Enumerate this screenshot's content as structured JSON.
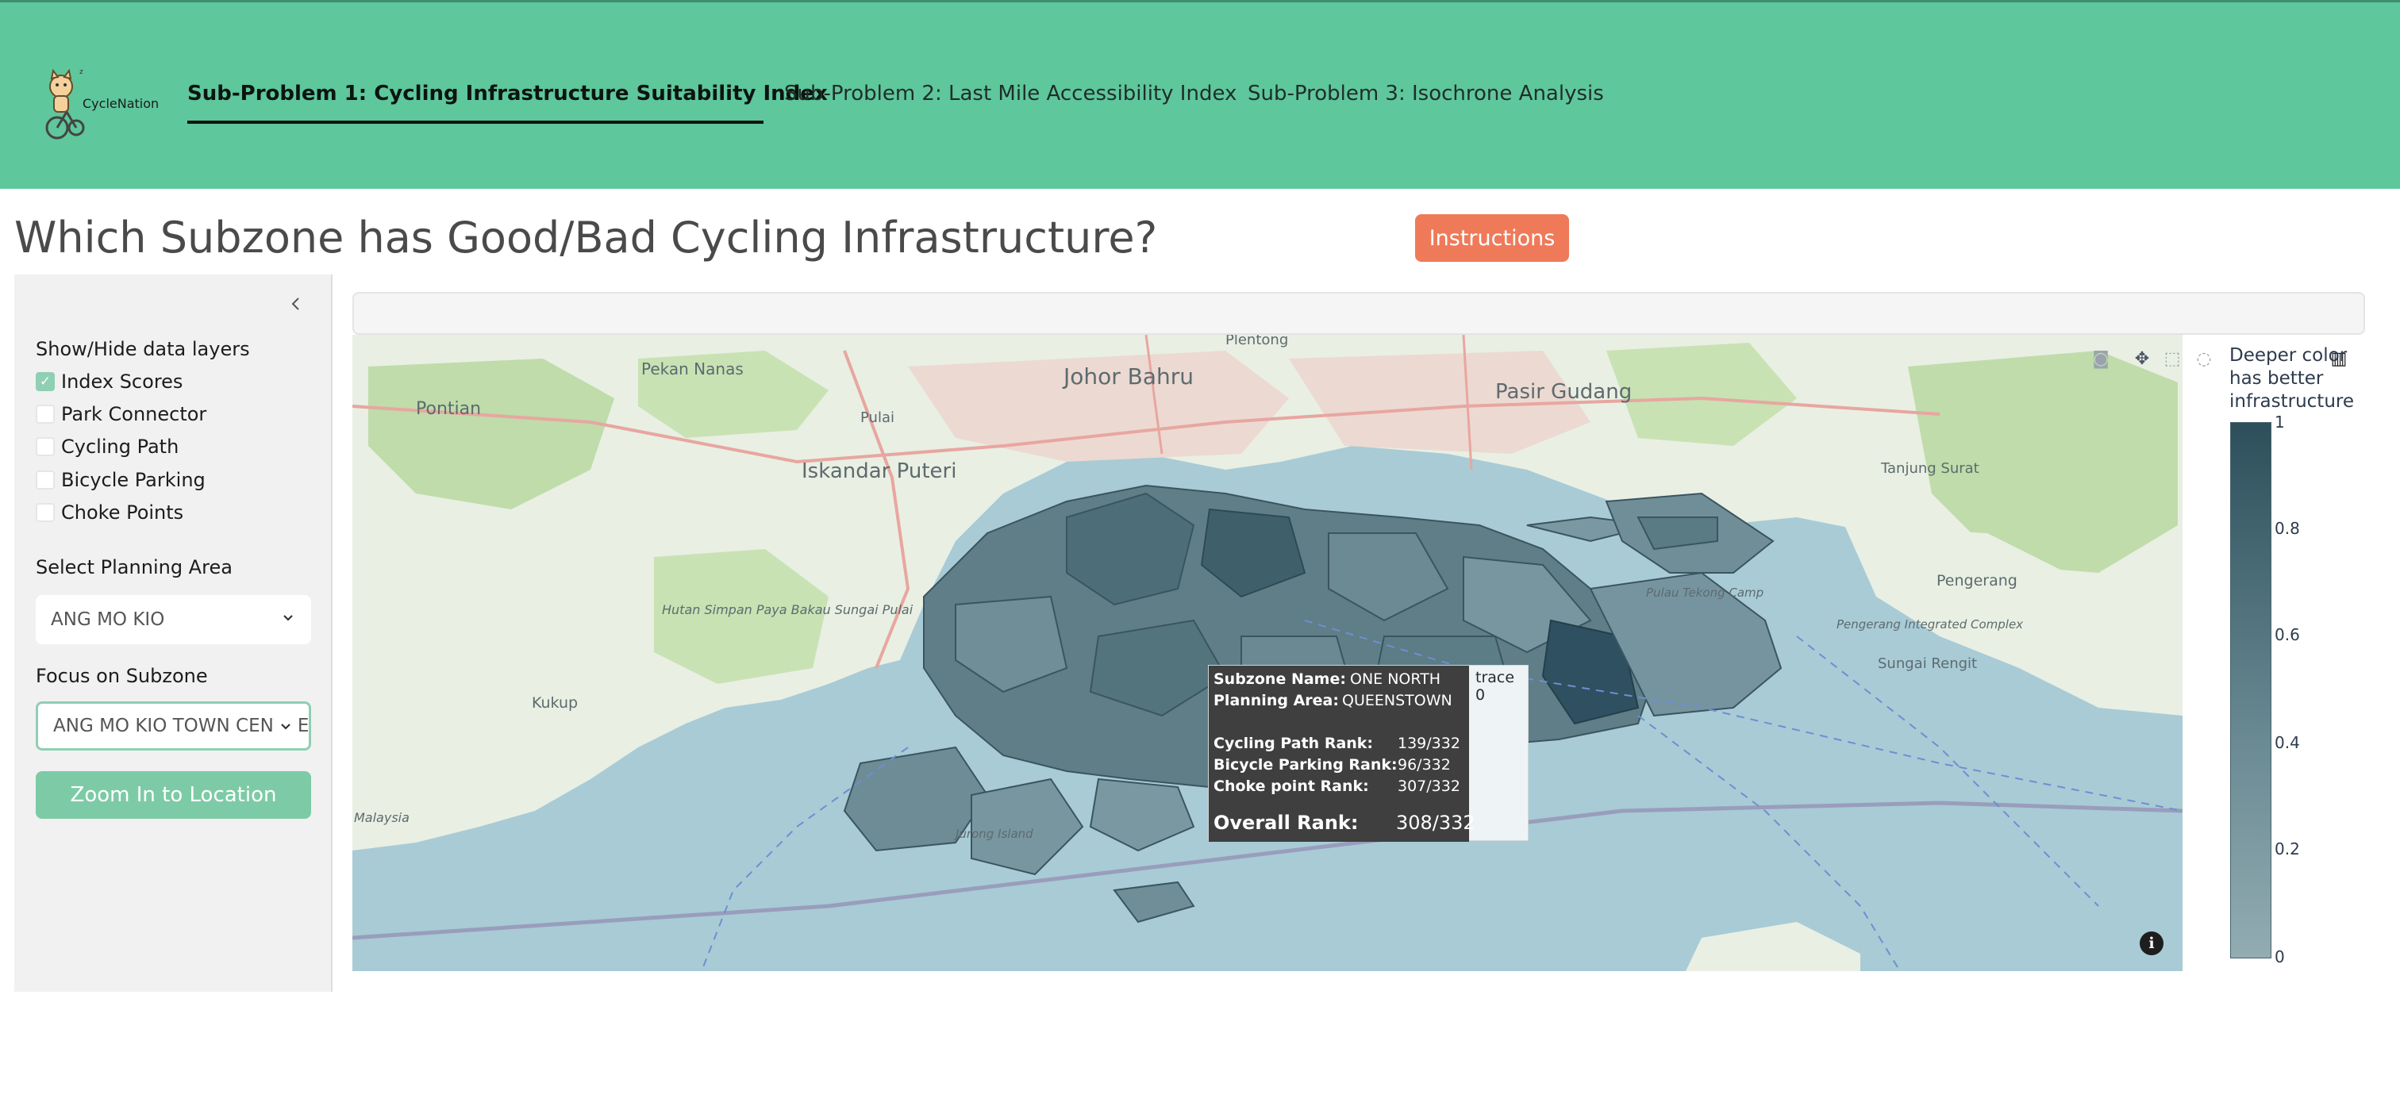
{
  "brand": {
    "name": "CycleNation"
  },
  "nav": {
    "tabs": [
      {
        "label": "Sub-Problem 1: Cycling Infrastructure Suitability Index",
        "active": true
      },
      {
        "label": "Sub-Problem 2: Last Mile Accessibility Index",
        "active": false
      },
      {
        "label": "Sub-Problem 3: Isochrone Analysis",
        "active": false
      }
    ]
  },
  "page": {
    "title": "Which Subzone has Good/Bad Cycling Infrastructure?",
    "instructions_label": "Instructions"
  },
  "sidebar": {
    "layers_heading": "Show/Hide data layers",
    "layers": [
      {
        "label": "Index Scores",
        "checked": true
      },
      {
        "label": "Park Connector",
        "checked": false
      },
      {
        "label": "Cycling Path",
        "checked": false
      },
      {
        "label": "Bicycle Parking",
        "checked": false
      },
      {
        "label": "Choke Points",
        "checked": false
      }
    ],
    "planning_area_label": "Select Planning Area",
    "planning_area_value": "ANG MO KIO",
    "subzone_label": "Focus on Subzone",
    "subzone_value": "ANG MO KIO TOWN CENTRE",
    "zoom_button": "Zoom In to Location"
  },
  "map": {
    "places": [
      "Pontian",
      "Pekan Nanas",
      "Johor Bahru",
      "Pasir Gudang",
      "Plentong",
      "Iskandar Puteri",
      "Pulai",
      "Tanjung Surat",
      "Pengerang",
      "Sungai Rengit",
      "Kukup",
      "Hutan Simpan Paya Bakau Sungai Pulai",
      "Pulau Tekong Camp",
      "Pengerang Integrated Complex",
      "Malaysia",
      "Jurong Island"
    ],
    "tooltip": {
      "subzone_name_key": "Subzone Name:",
      "subzone_name": "ONE NORTH",
      "planning_area_key": "Planning Area:",
      "planning_area": "QUEENSTOWN",
      "cycling_path_key": "Cycling Path Rank:",
      "cycling_path_rank": "139/332",
      "bicycle_parking_key": "Bicycle Parking Rank:",
      "bicycle_parking_rank": "96/332",
      "choke_point_key": "Choke point Rank:",
      "choke_point_rank": "307/332",
      "overall_key": "Overall Rank:",
      "overall_rank": "308/332",
      "trace": "trace 0"
    },
    "colorbar": {
      "title_lines": [
        "Deeper color",
        "has better",
        "infrastructure"
      ],
      "ticks": [
        "1",
        "0.8",
        "0.6",
        "0.4",
        "0.2",
        "0"
      ],
      "colors": {
        "high": "#2d4f5b",
        "low": "#92acb2"
      }
    },
    "info_icon": "i"
  },
  "colors": {
    "navbar": "#5ec79b",
    "instructions_button": "#ef7a5a",
    "zoom_button": "#7dcba6",
    "sea": "#a8cbd6",
    "land": "#e9efe3",
    "forest": "#bfdcaa"
  }
}
